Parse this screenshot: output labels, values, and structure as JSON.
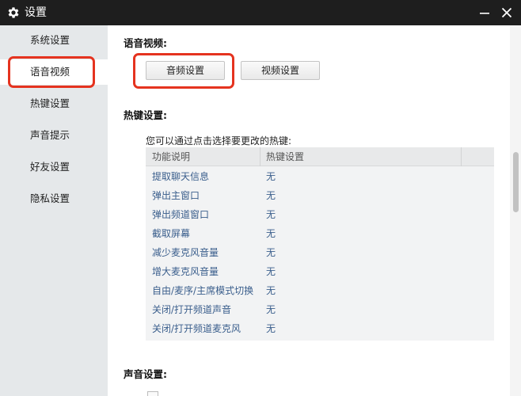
{
  "window": {
    "title": "设置",
    "icons": {
      "app": "gear-icon",
      "minimize": "minimize-icon",
      "close": "close-icon"
    }
  },
  "sidebar": {
    "items": [
      {
        "label": "系统设置",
        "active": false
      },
      {
        "label": "语音视频",
        "active": true
      },
      {
        "label": "热键设置",
        "active": false
      },
      {
        "label": "声音提示",
        "active": false
      },
      {
        "label": "好友设置",
        "active": false
      },
      {
        "label": "隐私设置",
        "active": false
      }
    ]
  },
  "voice_video": {
    "title": "语音视频:",
    "audio_button": "音频设置",
    "video_button": "视频设置"
  },
  "hotkeys": {
    "title": "热键设置:",
    "hint": "您可以通过点击选择要更改的热键:",
    "columns": [
      "功能说明",
      "热键设置"
    ],
    "rows": [
      {
        "function": "提取聊天信息",
        "key": "无"
      },
      {
        "function": "弹出主窗口",
        "key": "无"
      },
      {
        "function": "弹出频道窗口",
        "key": "无"
      },
      {
        "function": "截取屏幕",
        "key": "无"
      },
      {
        "function": "减少麦克风音量",
        "key": "无"
      },
      {
        "function": "增大麦克风音量",
        "key": "无"
      },
      {
        "function": "自由/麦序/主席模式切换",
        "key": "无"
      },
      {
        "function": "关闭/打开频道声音",
        "key": "无"
      },
      {
        "function": "关闭/打开频道麦克风",
        "key": "无"
      }
    ]
  },
  "sound": {
    "title": "声音设置:"
  },
  "colors": {
    "titlebar": "#1e1e1e",
    "sidebar": "#e5e8ea",
    "highlight": "#e5331f",
    "table_text": "#3a5e8c"
  }
}
